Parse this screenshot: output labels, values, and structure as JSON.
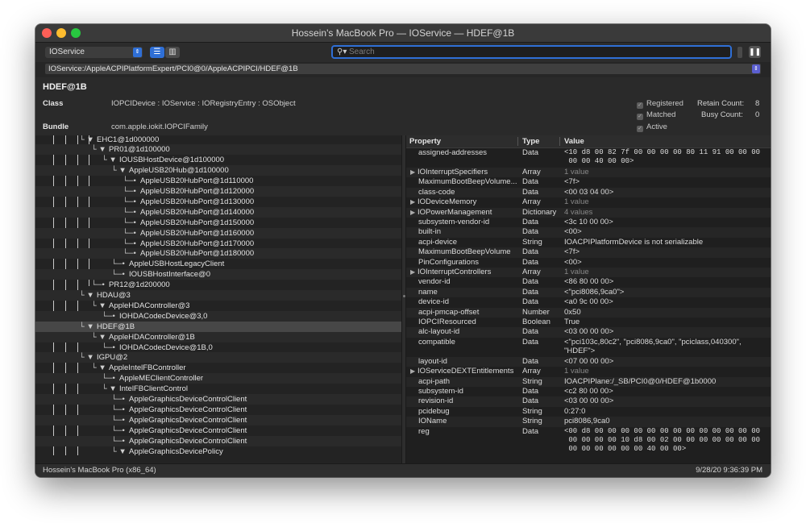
{
  "window": {
    "title": "Hossein's MacBook Pro — IOService — HDEF@1B"
  },
  "toolbar": {
    "plane": "IOService",
    "search_placeholder": "Search"
  },
  "path": "IOService:/AppleACPIPlatformExpert/PCI0@0/AppleACPIPCI/HDEF@1B",
  "info": {
    "name": "HDEF@1B",
    "class_label": "Class",
    "class_value": "IOPCIDevice : IOService : IORegistryEntry : OSObject",
    "bundle_label": "Bundle",
    "bundle_value": "com.apple.iokit.IOPCIFamily",
    "registered": "Registered",
    "matched": "Matched",
    "active": "Active",
    "retain_label": "Retain Count:",
    "retain_value": "8",
    "busy_label": "Busy Count:",
    "busy_value": "0"
  },
  "tree": [
    {
      "label": "EHC1@1d000000"
    },
    {
      "label": "PR01@1d100000"
    },
    {
      "label": "IOUSBHostDevice@1d100000"
    },
    {
      "label": "AppleUSB20Hub@1d100000"
    },
    {
      "label": "AppleUSB20HubPort@1d110000"
    },
    {
      "label": "AppleUSB20HubPort@1d120000"
    },
    {
      "label": "AppleUSB20HubPort@1d130000"
    },
    {
      "label": "AppleUSB20HubPort@1d140000"
    },
    {
      "label": "AppleUSB20HubPort@1d150000"
    },
    {
      "label": "AppleUSB20HubPort@1d160000"
    },
    {
      "label": "AppleUSB20HubPort@1d170000"
    },
    {
      "label": "AppleUSB20HubPort@1d180000"
    },
    {
      "label": "AppleUSBHostLegacyClient"
    },
    {
      "label": "IOUSBHostInterface@0"
    },
    {
      "label": "PR12@1d200000"
    },
    {
      "label": "HDAU@3"
    },
    {
      "label": "AppleHDAController@3"
    },
    {
      "label": "IOHDACodecDevice@3,0"
    },
    {
      "label": "HDEF@1B"
    },
    {
      "label": "AppleHDAController@1B"
    },
    {
      "label": "IOHDACodecDevice@1B,0"
    },
    {
      "label": "IGPU@2"
    },
    {
      "label": "AppleIntelFBController"
    },
    {
      "label": "AppleMEClientController"
    },
    {
      "label": "IntelFBClientControl"
    },
    {
      "label": "AppleGraphicsDeviceControlClient"
    },
    {
      "label": "AppleGraphicsDeviceControlClient"
    },
    {
      "label": "AppleGraphicsDeviceControlClient"
    },
    {
      "label": "AppleGraphicsDeviceControlClient"
    },
    {
      "label": "AppleGraphicsDeviceControlClient"
    },
    {
      "label": "AppleGraphicsDevicePolicy"
    }
  ],
  "properties": {
    "headers": {
      "property": "Property",
      "type": "Type",
      "value": "Value"
    },
    "rows": [
      {
        "name": "assigned-addresses",
        "type": "Data",
        "value": "<10 d8 00 82 7f 00 00 00 00 80 11 91 00 00 00\n 00 00 40 00 00>",
        "kind": "mono"
      },
      {
        "name": "IOInterruptSpecifiers",
        "type": "Array",
        "value": "1 value",
        "kind": "muted"
      },
      {
        "name": "MaximumBootBeepVolume...",
        "type": "Data",
        "value": "<7f>",
        "kind": ""
      },
      {
        "name": "class-code",
        "type": "Data",
        "value": "<00 03 04 00>",
        "kind": ""
      },
      {
        "name": "IODeviceMemory",
        "type": "Array",
        "value": "1 value",
        "kind": "muted"
      },
      {
        "name": "IOPowerManagement",
        "type": "Dictionary",
        "value": "4 values",
        "kind": "muted"
      },
      {
        "name": "subsystem-vendor-id",
        "type": "Data",
        "value": "<3c 10 00 00>",
        "kind": ""
      },
      {
        "name": "built-in",
        "type": "Data",
        "value": "<00>",
        "kind": ""
      },
      {
        "name": "acpi-device",
        "type": "String",
        "value": "IOACPIPlatformDevice is not serializable",
        "kind": ""
      },
      {
        "name": "MaximumBootBeepVolume",
        "type": "Data",
        "value": "<7f>",
        "kind": ""
      },
      {
        "name": "PinConfigurations",
        "type": "Data",
        "value": "<00>",
        "kind": ""
      },
      {
        "name": "IOInterruptControllers",
        "type": "Array",
        "value": "1 value",
        "kind": "muted"
      },
      {
        "name": "vendor-id",
        "type": "Data",
        "value": "<86 80 00 00>",
        "kind": ""
      },
      {
        "name": "name",
        "type": "Data",
        "value": "<\"pci8086,9ca0\">",
        "kind": ""
      },
      {
        "name": "device-id",
        "type": "Data",
        "value": "<a0 9c 00 00>",
        "kind": ""
      },
      {
        "name": "acpi-pmcap-offset",
        "type": "Number",
        "value": "0x50",
        "kind": ""
      },
      {
        "name": "IOPCIResourced",
        "type": "Boolean",
        "value": "True",
        "kind": ""
      },
      {
        "name": "alc-layout-id",
        "type": "Data",
        "value": "<03 00 00 00>",
        "kind": ""
      },
      {
        "name": "compatible",
        "type": "Data",
        "value": "<\"pci103c,80c2\", \"pci8086,9ca0\", \"pciclass,040300\", \"HDEF\">",
        "kind": "wrap"
      },
      {
        "name": "layout-id",
        "type": "Data",
        "value": "<07 00 00 00>",
        "kind": ""
      },
      {
        "name": "IOServiceDEXTEntitlements",
        "type": "Array",
        "value": "1 value",
        "kind": "muted"
      },
      {
        "name": "acpi-path",
        "type": "String",
        "value": "IOACPIPlane:/_SB/PCI0@0/HDEF@1b0000",
        "kind": ""
      },
      {
        "name": "subsystem-id",
        "type": "Data",
        "value": "<c2 80 00 00>",
        "kind": ""
      },
      {
        "name": "revision-id",
        "type": "Data",
        "value": "<03 00 00 00>",
        "kind": ""
      },
      {
        "name": "pcidebug",
        "type": "String",
        "value": "0:27:0",
        "kind": ""
      },
      {
        "name": "IOName",
        "type": "String",
        "value": "pci8086,9ca0",
        "kind": ""
      },
      {
        "name": "reg",
        "type": "Data",
        "value": "<00 d8 00 00 00 00 00 00 00 00 00 00 00 00 00\n 00 00 00 00 10 d8 00 02 00 00 00 00 00 00 00\n 00 00 00 00 00 00 40 00 00>",
        "kind": "mono"
      }
    ]
  },
  "status": {
    "machine": "Hossein's MacBook Pro (x86_64)",
    "timestamp": "9/28/20 9:36:39 PM"
  }
}
